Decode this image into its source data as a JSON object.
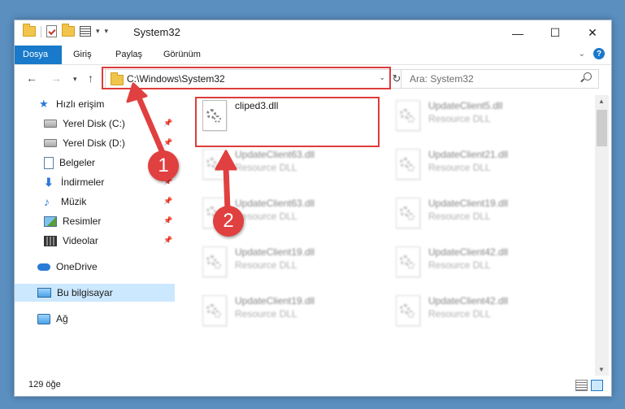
{
  "window": {
    "title": "System32"
  },
  "ribbon": {
    "tabs": [
      "Dosya",
      "Giriş",
      "Paylaş",
      "Görünüm"
    ],
    "active_tab": "Dosya"
  },
  "address": {
    "path": "C:\\Windows\\System32"
  },
  "search": {
    "placeholder": "Ara: System32"
  },
  "sidebar": {
    "items": [
      {
        "label": "Hızlı erişim",
        "icon": "quick-access-star-icon",
        "pinned": false
      },
      {
        "label": "Yerel Disk (C:)",
        "icon": "drive-icon",
        "pinned": true
      },
      {
        "label": "Yerel Disk (D:)",
        "icon": "drive-icon",
        "pinned": true
      },
      {
        "label": "Belgeler",
        "icon": "documents-icon",
        "pinned": true
      },
      {
        "label": "İndirmeler",
        "icon": "downloads-icon",
        "pinned": true
      },
      {
        "label": "Müzik",
        "icon": "music-icon",
        "pinned": true
      },
      {
        "label": "Resimler",
        "icon": "pictures-icon",
        "pinned": true
      },
      {
        "label": "Videolar",
        "icon": "videos-icon",
        "pinned": true
      },
      {
        "label": "OneDrive",
        "icon": "onedrive-cloud-icon",
        "pinned": false
      },
      {
        "label": "Bu bilgisayar",
        "icon": "this-pc-icon",
        "pinned": false,
        "selected": true
      },
      {
        "label": "Ağ",
        "icon": "network-icon",
        "pinned": false
      }
    ]
  },
  "files": [
    {
      "name": "cliped3.dll",
      "type": "",
      "highlighted": true
    },
    {
      "name": "UpdateClient5.dll",
      "type": "Resource DLL"
    },
    {
      "name": "UpdateClient63.dll",
      "type": "Resource DLL"
    },
    {
      "name": "UpdateClient21.dll",
      "type": "Resource DLL"
    },
    {
      "name": "UpdateClient63.dll",
      "type": "Resource DLL"
    },
    {
      "name": "UpdateClient19.dll",
      "type": "Resource DLL"
    },
    {
      "name": "UpdateClient19.dll",
      "type": "Resource DLL"
    },
    {
      "name": "UpdateClient42.dll",
      "type": "Resource DLL"
    },
    {
      "name": "UpdateClient19.dll",
      "type": "Resource DLL"
    },
    {
      "name": "UpdateClient42.dll",
      "type": "Resource DLL"
    }
  ],
  "status": {
    "item_count": "129 öğe"
  },
  "annotations": {
    "step1": "1",
    "step2": "2",
    "color": "#e0403f"
  }
}
